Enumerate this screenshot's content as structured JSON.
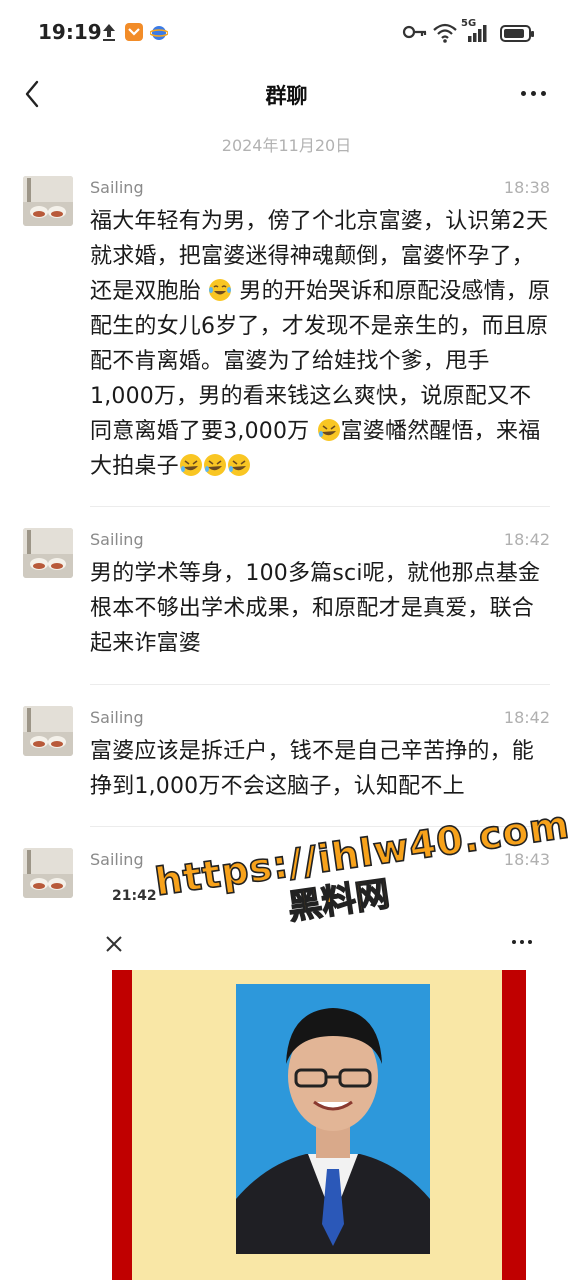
{
  "status_bar": {
    "time": "19:19",
    "network": "5G",
    "icons": [
      "upload-icon",
      "shield-app-icon",
      "browser-app-icon",
      "key-icon",
      "wifi-icon",
      "signal-icon",
      "battery-icon"
    ]
  },
  "nav": {
    "title": "群聊",
    "back_icon": "chevron-left-icon",
    "more_icon": "more-dots-icon"
  },
  "date_separator": "2024年11月20日",
  "messages": [
    {
      "sender": "Sailing",
      "time": "18:38",
      "text_1": "福大年轻有为男，傍了个北京富婆，认识第2天就求婚，把富婆迷得神魂颠倒，富婆怀孕了，还是双胞胎",
      "text_2": "男的开始哭诉和原配没感情，原配生的女儿6岁了，才发现不是亲生的，而且原配不肯离婚。富婆为了给娃找个爹，甩手1,000万，男的看来钱这么爽快，说原配又不同意离婚了要3,000万",
      "text_3": "富婆幡然醒悟，来福大拍桌子"
    },
    {
      "sender": "Sailing",
      "time": "18:42",
      "text": "男的学术等身，100多篇sci呢，就他那点基金根本不够出学术成果，和原配才是真爱，联合起来诈富婆"
    },
    {
      "sender": "Sailing",
      "time": "18:42",
      "text": "富婆应该是拆迁户，钱不是自己辛苦挣的，能挣到1,000万不会这脑子，认知配不上"
    },
    {
      "sender": "Sailing",
      "time": "18:43",
      "embedded_screenshot": {
        "time": "21:42",
        "close_icon": "close-icon",
        "more_icon": "more-dots-icon"
      }
    }
  ],
  "watermark": {
    "url": "https://ihlw40.com",
    "text": "黑料网"
  },
  "colors": {
    "background": "#ffffff",
    "watermark": "#f7a21b",
    "certificate_red": "#c00000",
    "certificate_yellow": "#f9e7a6",
    "photo_blue": "#2d98db"
  }
}
